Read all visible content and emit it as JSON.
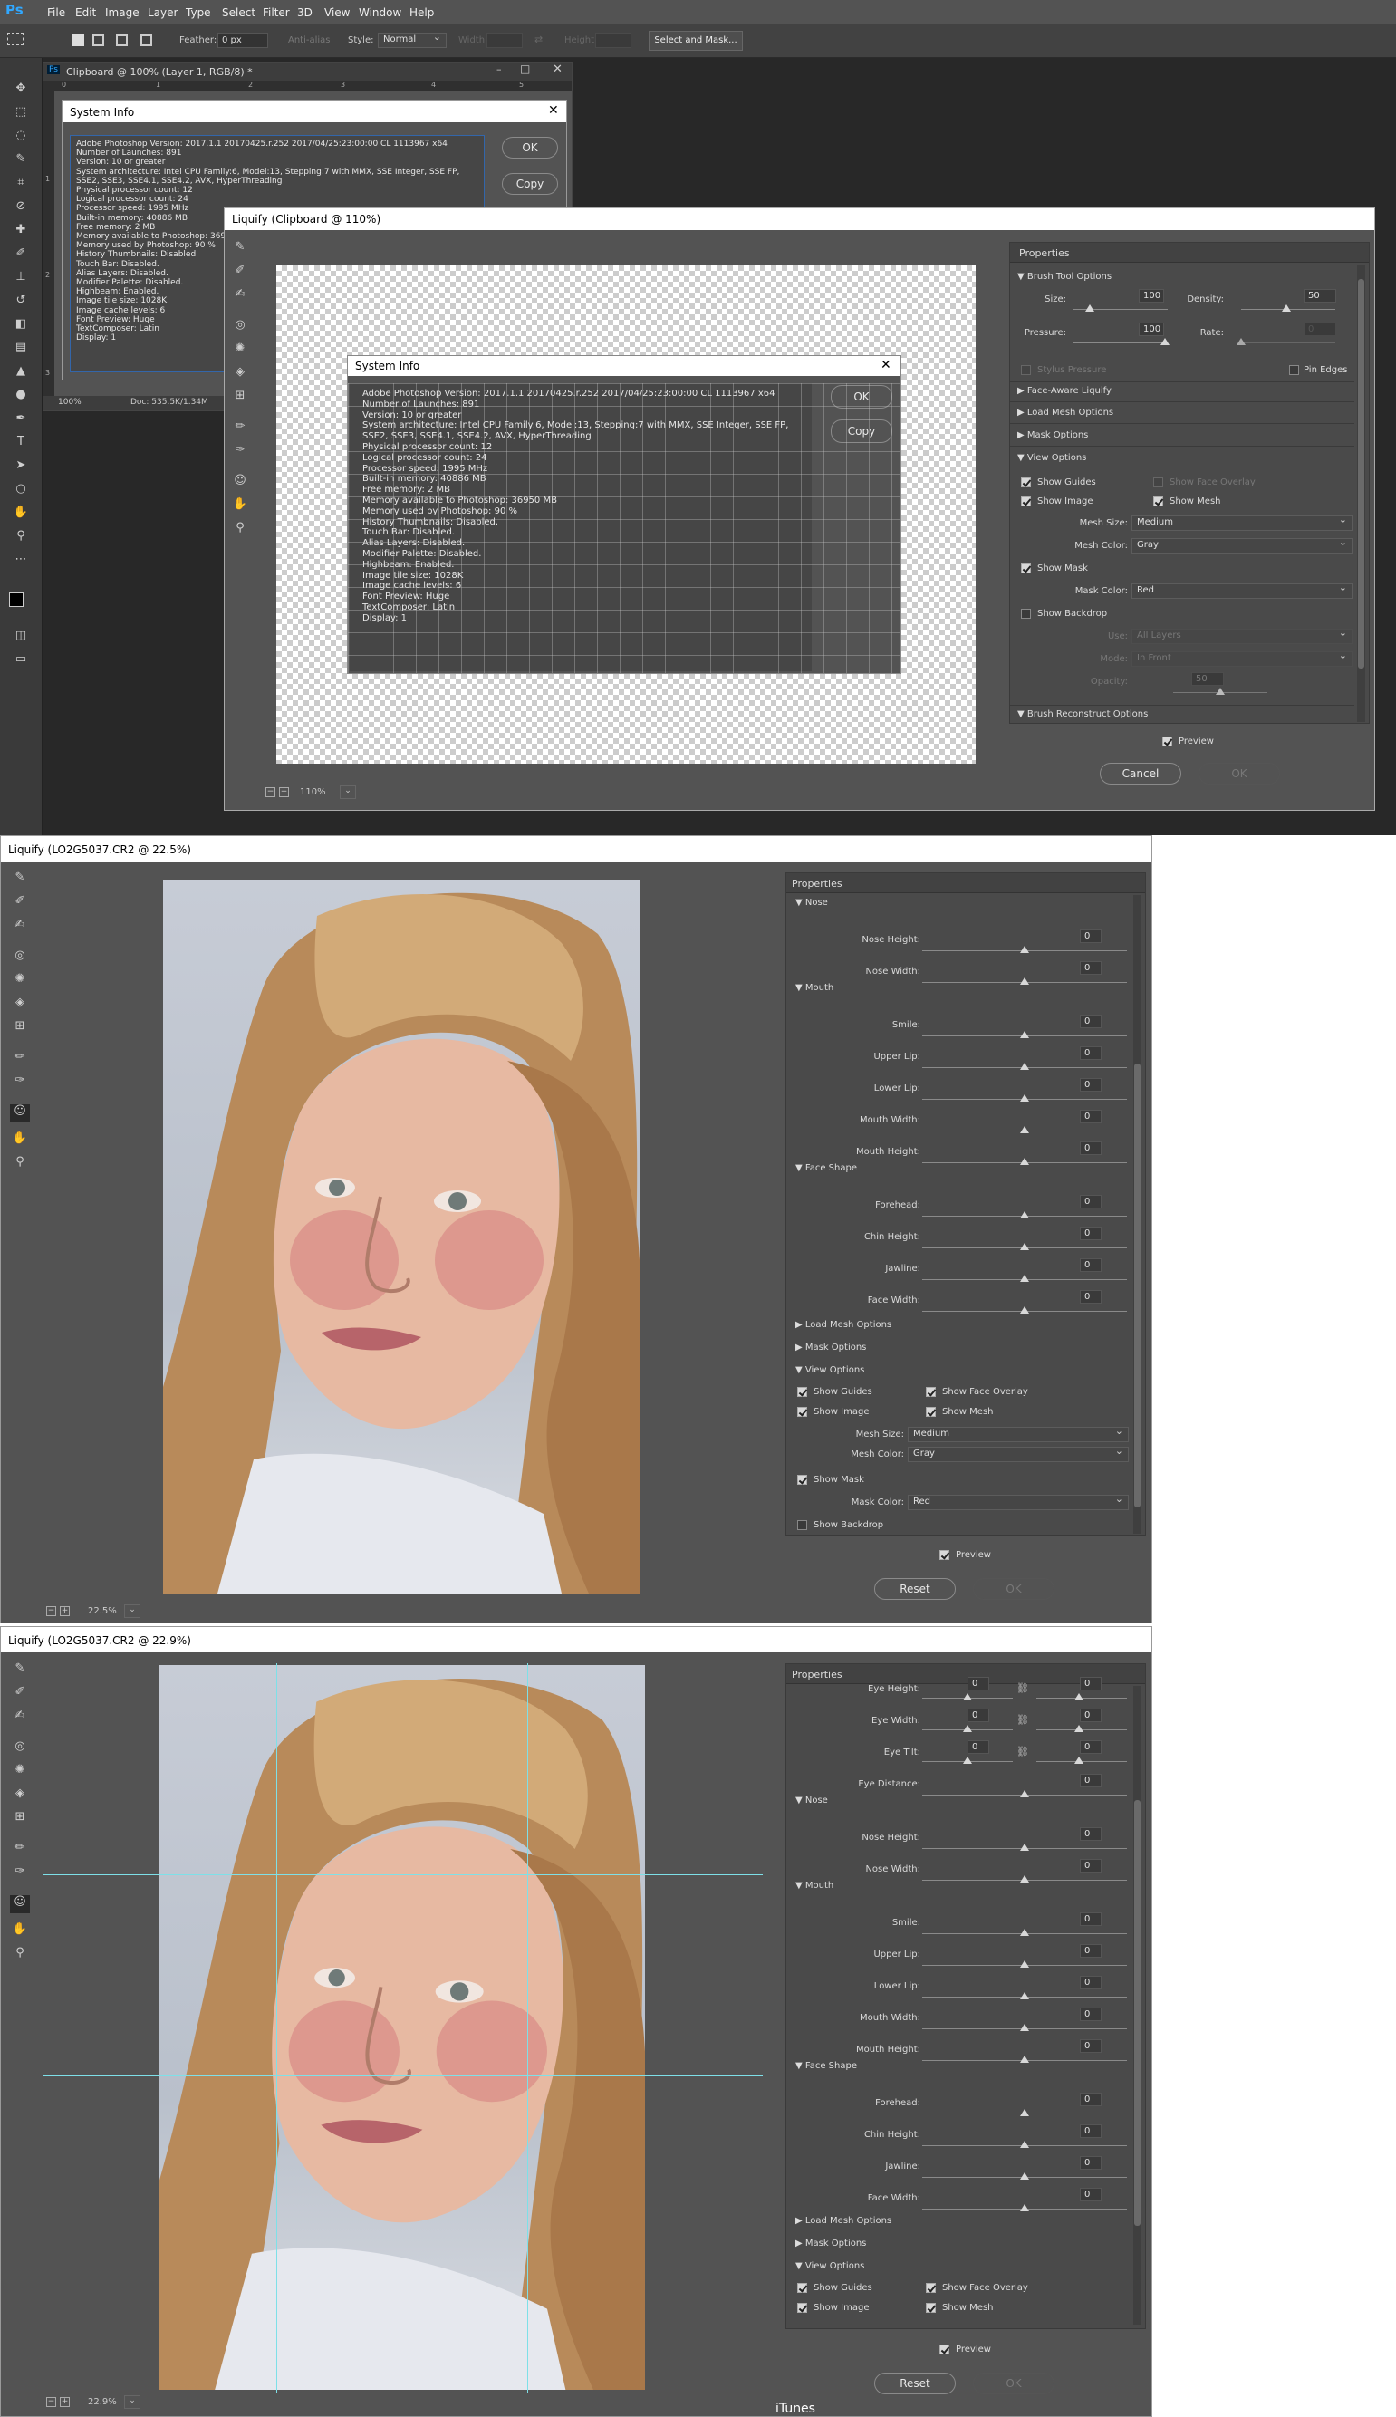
{
  "menubar": {
    "logo": "Ps",
    "items": [
      "File",
      "Edit",
      "Image",
      "Layer",
      "Type",
      "Select",
      "Filter",
      "3D",
      "View",
      "Window",
      "Help"
    ]
  },
  "options": {
    "feather_label": "Feather:",
    "feather_value": "0 px",
    "antialias": "Anti-alias",
    "style_label": "Style:",
    "style_value": "Normal",
    "width_label": "Width:",
    "height_label": "Height:",
    "select_mask": "Select and Mask..."
  },
  "doc": {
    "title": "Clipboard @ 100% (Layer 1, RGB/8) *",
    "zoom": "100%",
    "docsize": "Doc: 535.5K/1.34M",
    "ruler": [
      "0",
      "1",
      "2",
      "3",
      "4",
      "5"
    ],
    "vruler": [
      "1",
      "2",
      "3"
    ]
  },
  "sysinfo": {
    "title": "System Info",
    "ok": "OK",
    "copy": "Copy",
    "lines": [
      "Adobe Photoshop Version: 2017.1.1 20170425.r.252 2017/04/25:23:00:00 CL 1113967  x64",
      "Number of Launches: 891",
      "Version: 10 or greater",
      "System architecture: Intel CPU Family:6, Model:13, Stepping:7 with MMX, SSE Integer, SSE FP,",
      "SSE2, SSE3, SSE4.1, SSE4.2, AVX, HyperThreading",
      "Physical processor count: 12",
      "Logical processor count: 24",
      "Processor speed: 1995 MHz",
      "Built-in memory: 40886 MB",
      "Free memory: 2 MB",
      "Memory available to Photoshop: 36950 MB",
      "Memory used by Photoshop: 90 %",
      "History Thumbnails: Disabled.",
      "Touch Bar: Disabled.",
      "Alias Layers: Disabled.",
      "Modifier Palette: Disabled.",
      "Highbeam: Enabled.",
      "Image tile size: 1028K",
      "Image cache levels: 6",
      "Font Preview: Huge",
      "TextComposer: Latin",
      "Display: 1"
    ]
  },
  "liquify1": {
    "title": "Liquify (Clipboard @ 110%)",
    "zoom": "110%",
    "properties": "Properties",
    "brush_tool_options": "Brush Tool Options",
    "size_label": "Size:",
    "size": "100",
    "density_label": "Density:",
    "density": "50",
    "pressure_label": "Pressure:",
    "pressure": "100",
    "rate_label": "Rate:",
    "rate": "0",
    "stylus": "Stylus Pressure",
    "pin_edges": "Pin Edges",
    "face_aware": "Face-Aware Liquify",
    "load_mesh": "Load Mesh Options",
    "mask_options": "Mask Options",
    "view_options": "View Options",
    "show_guides": "Show Guides",
    "show_face_overlay": "Show Face Overlay",
    "show_image": "Show Image",
    "show_mesh": "Show Mesh",
    "mesh_size_label": "Mesh Size:",
    "mesh_size": "Medium",
    "mesh_color_label": "Mesh Color:",
    "mesh_color": "Gray",
    "show_mask": "Show Mask",
    "mask_color_label": "Mask Color:",
    "mask_color": "Red",
    "show_backdrop": "Show Backdrop",
    "use_label": "Use:",
    "use": "All Layers",
    "mode_label": "Mode:",
    "mode": "In Front",
    "opacity_label": "Opacity:",
    "opacity": "50",
    "brush_reconstruct": "Brush Reconstruct Options",
    "preview": "Preview",
    "cancel": "Cancel",
    "ok": "OK"
  },
  "liquify2": {
    "title": "Liquify (LO2G5037.CR2 @ 22.5%)",
    "zoom": "22.5%",
    "properties": "Properties",
    "nose": "Nose",
    "nose_height": "Nose Height:",
    "nose_width": "Nose Width:",
    "mouth": "Mouth",
    "smile": "Smile:",
    "upper_lip": "Upper Lip:",
    "lower_lip": "Lower Lip:",
    "mouth_width": "Mouth Width:",
    "mouth_height": "Mouth Height:",
    "face_shape": "Face Shape",
    "forehead": "Forehead:",
    "chin_height": "Chin Height:",
    "jawline": "Jawline:",
    "face_width": "Face Width:",
    "zero": "0",
    "load_mesh": "Load Mesh Options",
    "mask_options": "Mask Options",
    "view_options": "View Options",
    "show_guides": "Show Guides",
    "show_face_overlay": "Show Face Overlay",
    "show_image": "Show Image",
    "show_mesh": "Show Mesh",
    "mesh_size_label": "Mesh Size:",
    "mesh_size": "Medium",
    "mesh_color_label": "Mesh Color:",
    "mesh_color": "Gray",
    "show_mask": "Show Mask",
    "mask_color_label": "Mask Color:",
    "mask_color": "Red",
    "show_backdrop": "Show Backdrop",
    "preview": "Preview",
    "reset": "Reset",
    "ok": "OK"
  },
  "liquify3": {
    "title": "Liquify (LO2G5037.CR2 @ 22.9%)",
    "zoom": "22.9%",
    "properties": "Properties",
    "eye_height": "Eye Height:",
    "eye_width": "Eye Width:",
    "eye_tilt": "Eye Tilt:",
    "eye_distance": "Eye Distance:",
    "nose": "Nose",
    "nose_height": "Nose Height:",
    "nose_width": "Nose Width:",
    "mouth": "Mouth",
    "smile": "Smile:",
    "upper_lip": "Upper Lip:",
    "lower_lip": "Lower Lip:",
    "mouth_width": "Mouth Width:",
    "mouth_height": "Mouth Height:",
    "face_shape": "Face Shape",
    "forehead": "Forehead:",
    "chin_height": "Chin Height:",
    "jawline": "Jawline:",
    "face_width": "Face Width:",
    "zero": "0",
    "load_mesh": "Load Mesh Options",
    "mask_options": "Mask Options",
    "view_options": "View Options",
    "show_guides": "Show Guides",
    "show_face_overlay": "Show Face Overlay",
    "show_image": "Show Image",
    "show_mesh": "Show Mesh",
    "preview": "Preview",
    "reset": "Reset",
    "ok": "OK"
  },
  "taskbar_label": "iTunes"
}
